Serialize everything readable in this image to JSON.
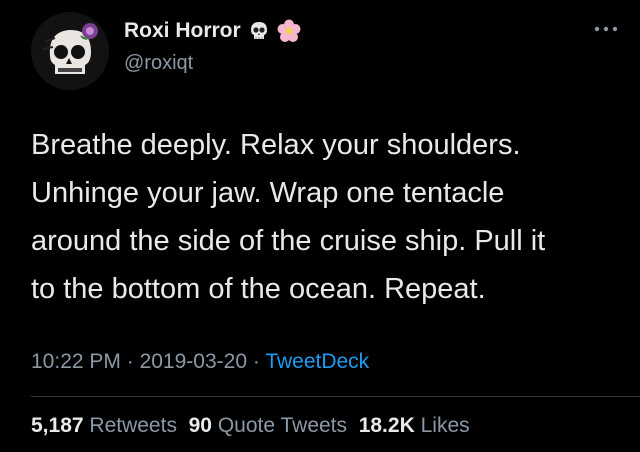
{
  "author": {
    "display_name": "Roxi Horror",
    "handle": "@roxiqt",
    "name_emojis": [
      "skull-emoji",
      "cherry-blossom-emoji"
    ],
    "avatar_icon": "skull-with-rose-avatar"
  },
  "more_icon": "ellipsis-icon",
  "tweet": {
    "lines": [
      "Breathe deeply. Relax your shoulders.",
      "Unhinge your jaw. Wrap one tentacle",
      "around the side of the cruise ship. Pull it",
      "to the bottom of the ocean. Repeat."
    ],
    "time": "10:22 PM",
    "separator": "·",
    "date": "2019-03-20",
    "source": "TweetDeck"
  },
  "stats": {
    "retweets_count": "5,187",
    "retweets_label": "Retweets",
    "quotes_count": "90",
    "quotes_label": "Quote Tweets",
    "likes_count": "18.2K",
    "likes_label": "Likes"
  },
  "colors": {
    "background": "#000000",
    "text": "#e7e9ea",
    "secondary": "#8b98a5",
    "link": "#1d9bf0"
  }
}
